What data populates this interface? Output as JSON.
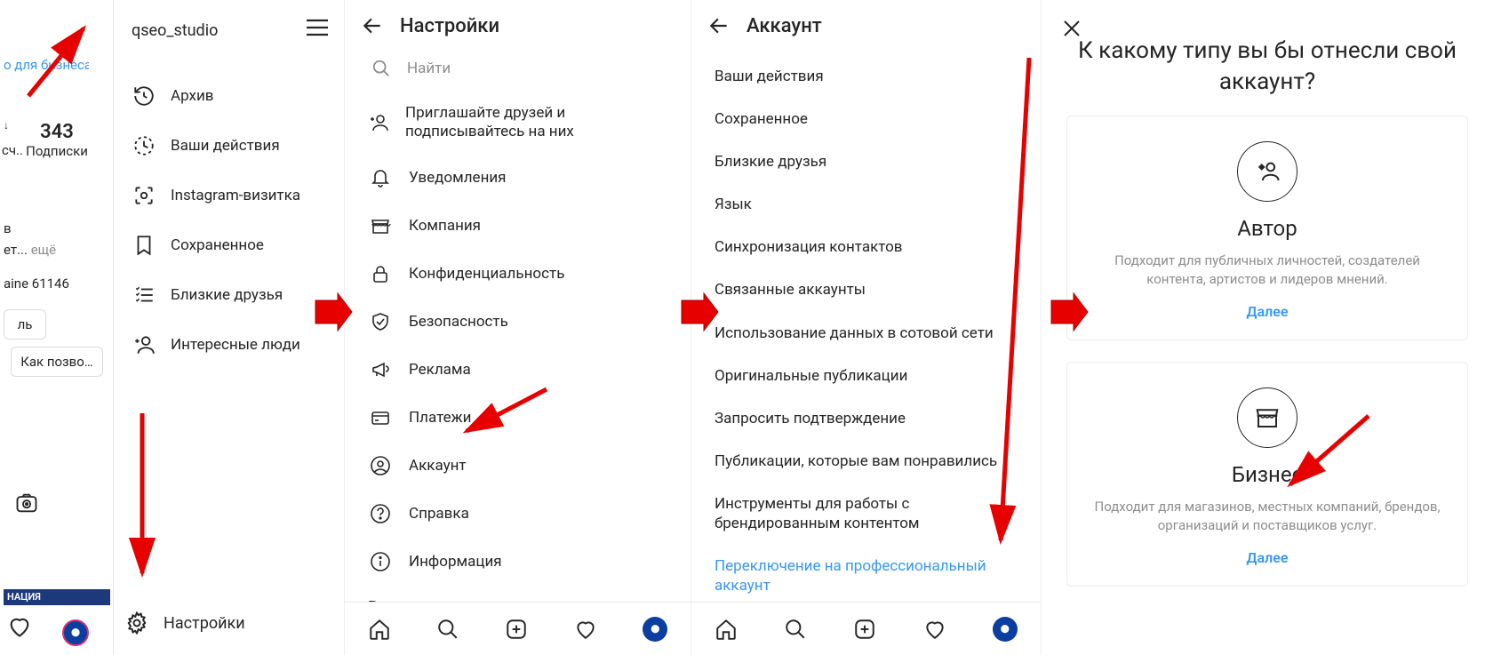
{
  "panel1": {
    "business_link": "о для бизнеса",
    "stat_count": "343",
    "stat_label": "Подписки",
    "frag1_suffix": "сч..",
    "frag2a": "в",
    "frag2b": "ет...",
    "frag2_more": "ещё",
    "location_fragment": "aine 61146",
    "button1": "ль",
    "button2": "Как позво…",
    "nav_banner": "НАЦИЯ",
    "username": "qseo_studio",
    "menu": [
      {
        "icon": "history-icon",
        "label": "Архив"
      },
      {
        "icon": "clock-icon",
        "label": "Ваши действия"
      },
      {
        "icon": "nametag-icon",
        "label": "Instagram-визитка"
      },
      {
        "icon": "bookmark-icon",
        "label": "Сохраненное"
      },
      {
        "icon": "list-icon",
        "label": "Близкие друзья"
      },
      {
        "icon": "adduser-icon",
        "label": "Интересные люди"
      }
    ],
    "settings_label": "Настройки"
  },
  "panel2": {
    "title": "Настройки",
    "search_placeholder": "Найти",
    "items": [
      {
        "icon": "adduser-icon",
        "label": "Приглашайте друзей и подписывайтесь на них",
        "multiline": true
      },
      {
        "icon": "bell-icon",
        "label": "Уведомления"
      },
      {
        "icon": "shop-icon",
        "label": "Компания"
      },
      {
        "icon": "lock-icon",
        "label": "Конфиденциальность"
      },
      {
        "icon": "shield-icon",
        "label": "Безопасность"
      },
      {
        "icon": "megaphone-icon",
        "label": "Реклама"
      },
      {
        "icon": "card-icon",
        "label": "Платежи"
      },
      {
        "icon": "user-circle-icon",
        "label": "Аккаунт"
      },
      {
        "icon": "help-icon",
        "label": "Справка"
      },
      {
        "icon": "info-icon",
        "label": "Информация"
      }
    ],
    "section_label": "Входы"
  },
  "panel3": {
    "title": "Аккаунт",
    "items": [
      "Ваши действия",
      "Сохраненное",
      "Близкие друзья",
      "Язык",
      "Синхронизация контактов",
      "Связанные аккаунты",
      "Использование данных в сотовой сети",
      "Оригинальные публикации",
      "Запросить подтверждение",
      "Публикации, которые вам понравились",
      "Инструменты для работы с брендированным контентом"
    ],
    "switch_link": "Переключение на профессиональный аккаунт"
  },
  "panel4": {
    "question": "К какому типу вы бы отнесли свой аккаунт?",
    "card_author": {
      "title": "Автор",
      "desc": "Подходит для публичных личностей, создателей контента, артистов и лидеров мнений.",
      "next": "Далее"
    },
    "card_business": {
      "title": "Бизнес",
      "desc": "Подходит для магазинов, местных компаний, брендов, организаций и поставщиков услуг.",
      "next": "Далее"
    }
  }
}
